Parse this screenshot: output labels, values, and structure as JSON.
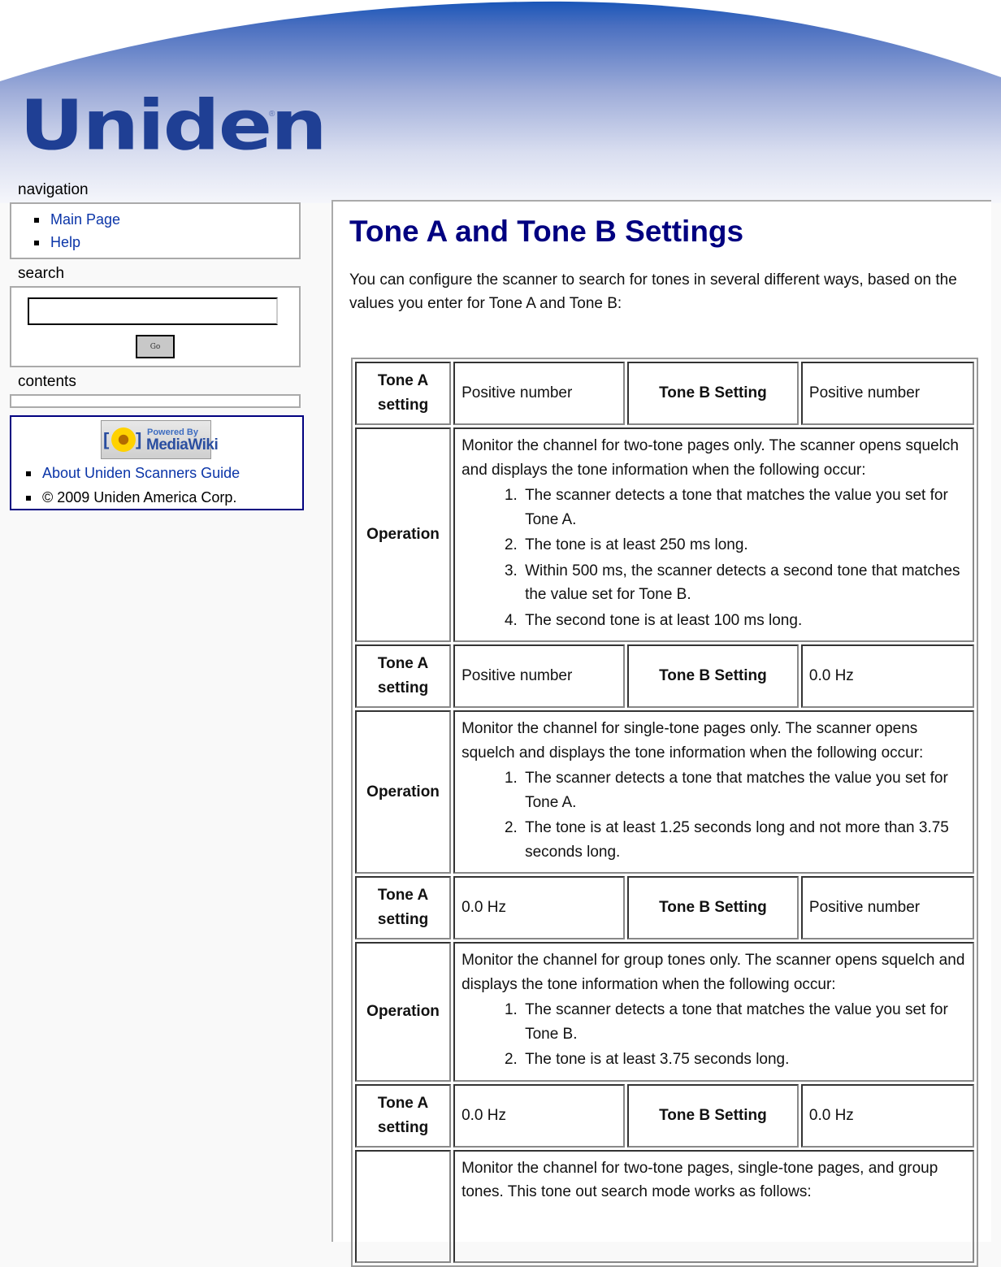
{
  "header": {
    "logo_text": "Uniden",
    "logo_reg": "®",
    "colors": {
      "brand_blue": "#1f3f94",
      "banner_blue": "#2d5cb8"
    }
  },
  "sidebar": {
    "navigation": {
      "title": "navigation",
      "items": [
        {
          "label": "Main Page"
        },
        {
          "label": "Help"
        }
      ]
    },
    "search": {
      "title": "search",
      "input_value": "",
      "go_label": "Go"
    },
    "contents": {
      "title": "contents"
    },
    "footer": {
      "badge": {
        "line1": "Powered By",
        "line2": "MediaWiki",
        "brackets_left": "[",
        "brackets_right": "]"
      },
      "items": [
        {
          "label": "About Uniden Scanners Guide",
          "is_link": true
        },
        {
          "label": "© 2009 Uniden America Corp.",
          "is_link": false
        }
      ]
    }
  },
  "main": {
    "title": "Tone A and Tone B Settings",
    "intro": "You can configure the scanner to search for tones in several different ways, based on the values you enter for Tone A and Tone B:",
    "table": {
      "tone_a_label": "Tone A setting",
      "tone_b_label": "Tone B Setting",
      "operation_label": "Operation",
      "rows": [
        {
          "tone_a": "Positive number",
          "tone_b": "Positive number",
          "operation_text": "Monitor the channel for two-tone pages only. The scanner opens squelch and displays the tone information when the following occur:",
          "steps": [
            "The scanner detects a tone that matches the value you set for Tone A.",
            "The tone is at least 250 ms long.",
            "Within 500 ms, the scanner detects a second tone that matches the value set for Tone B.",
            "The second tone is at least 100 ms long."
          ]
        },
        {
          "tone_a": "Positive number",
          "tone_b": "0.0 Hz",
          "operation_text": "Monitor the channel for single-tone pages only. The scanner opens squelch and displays the tone information when the following occur:",
          "steps": [
            "The scanner detects a tone that matches the value you set for Tone A.",
            "The tone is at least 1.25 seconds long and not more than 3.75 seconds long."
          ]
        },
        {
          "tone_a": "0.0 Hz",
          "tone_b": "Positive number",
          "operation_text": "Monitor the channel for group tones only. The scanner opens squelch and displays the tone information when the following occur:",
          "steps": [
            "The scanner detects a tone that matches the value you set for Tone B.",
            "The tone is at least 3.75 seconds long."
          ]
        },
        {
          "tone_a": "0.0 Hz",
          "tone_b": "0.0 Hz",
          "operation_text": "Monitor the channel for two-tone pages, single-tone pages, and group tones. This tone out search mode works as follows:",
          "steps": []
        }
      ]
    }
  }
}
